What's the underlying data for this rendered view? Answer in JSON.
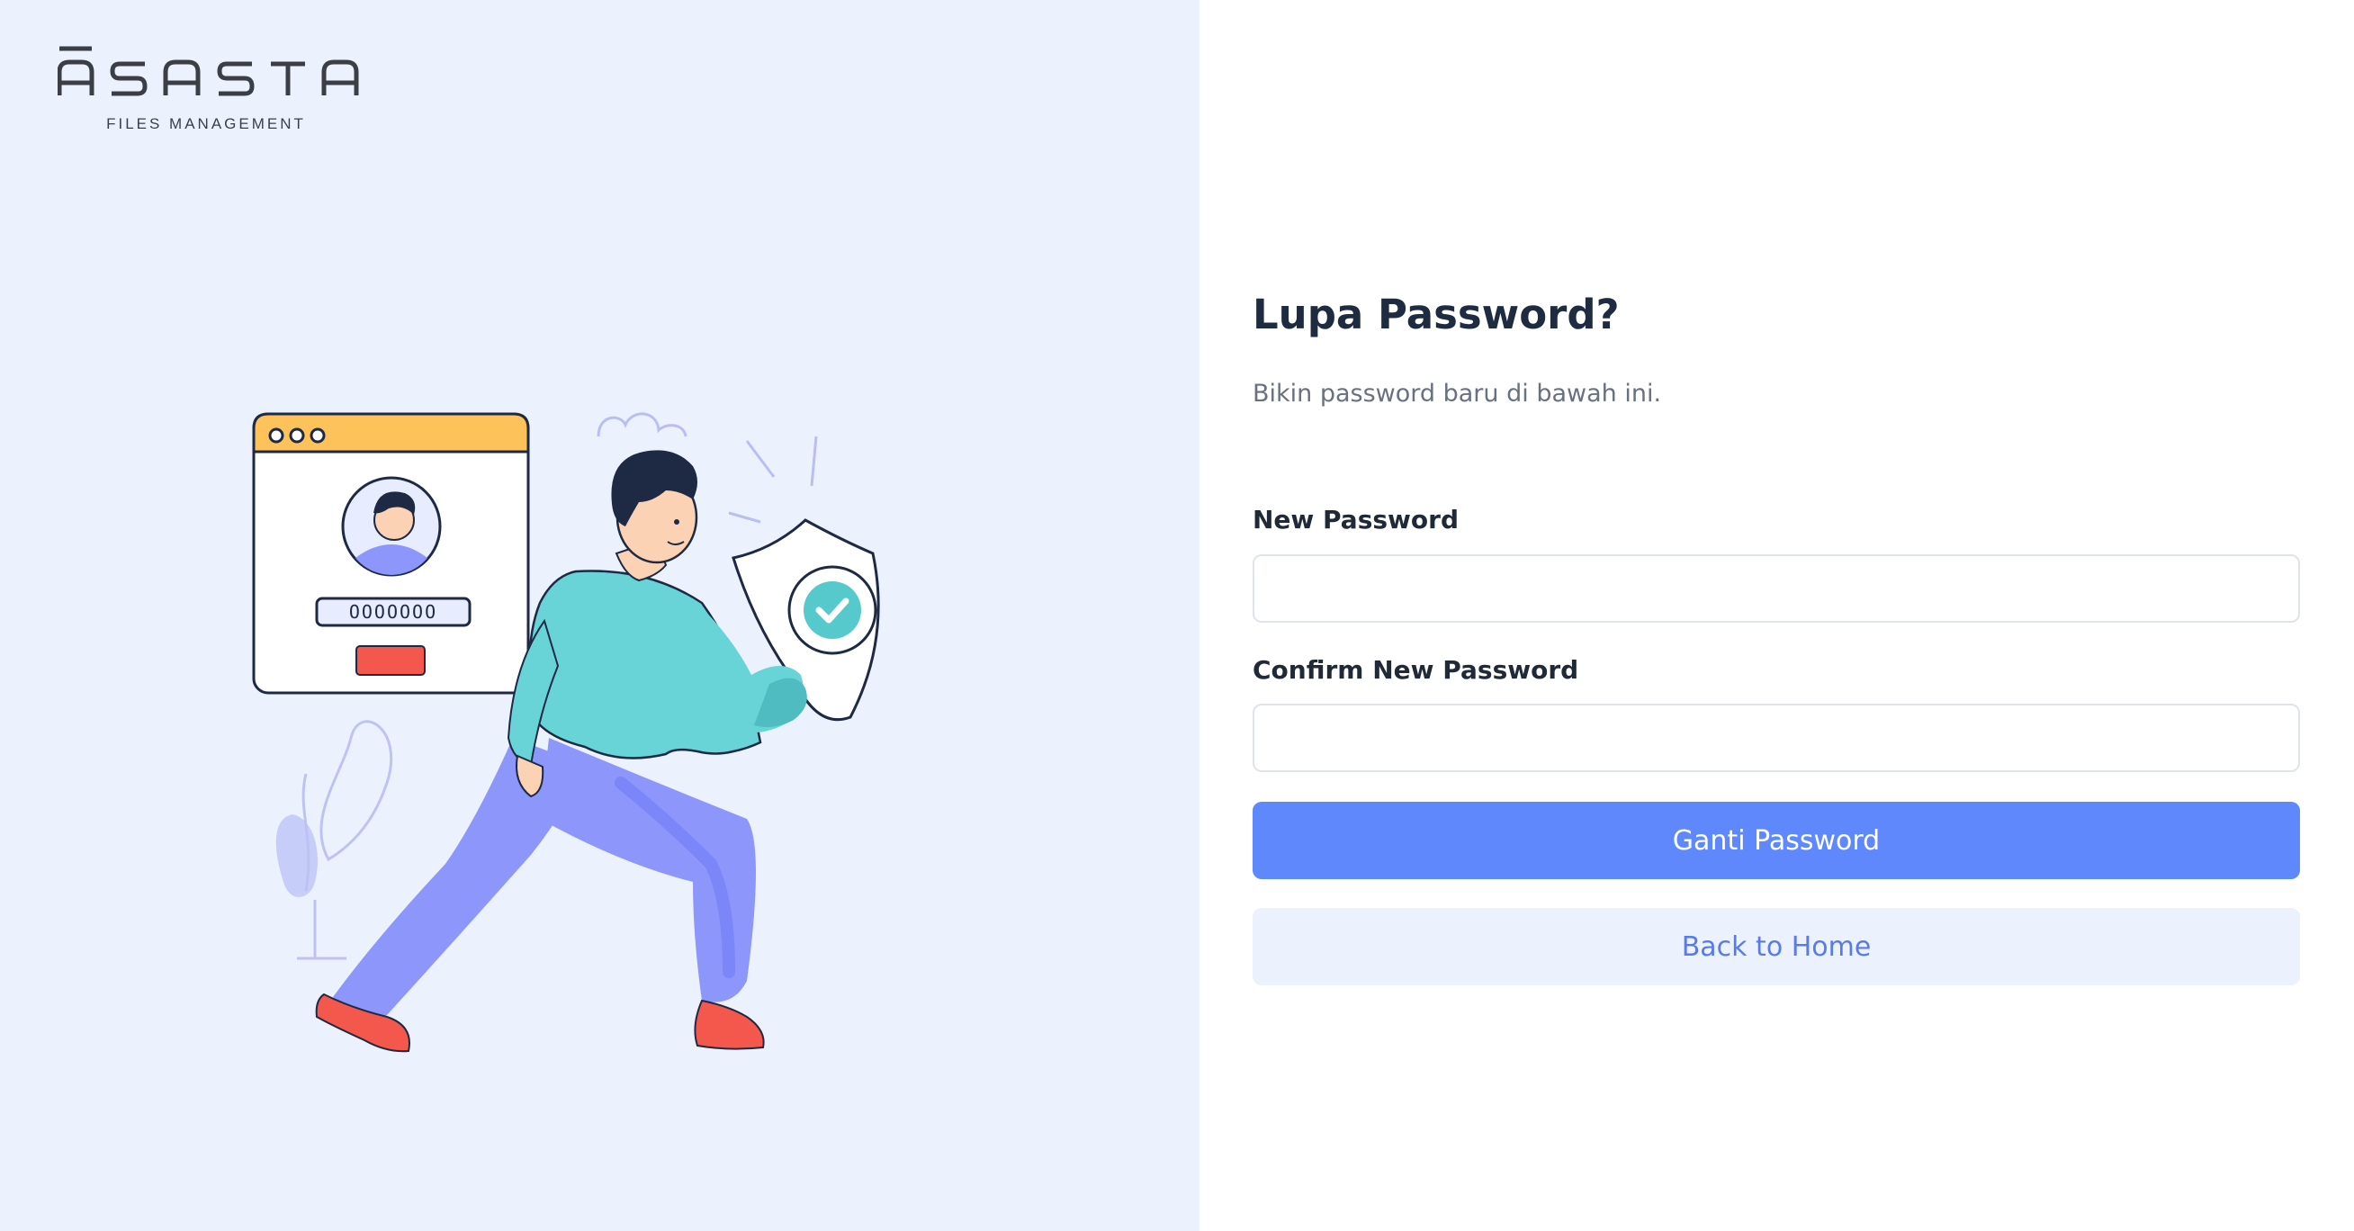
{
  "brand": {
    "name": "ĀSASTA",
    "tagline": "FILES MANAGEMENT"
  },
  "illustration": {
    "password_mask": "OOOOOOO",
    "colors": {
      "panel_background": "#ebf2fd",
      "shirt": "#68d4d8",
      "pants": "#8c96fb",
      "shoes": "#f4574b",
      "window_bar": "#fec25b",
      "window_button": "#f4574b",
      "shield_check": "#56c9cd"
    }
  },
  "form": {
    "title": "Lupa Password?",
    "subtitle": "Bikin password baru di bawah ini.",
    "new_password": {
      "label": "New Password",
      "value": "",
      "placeholder": ""
    },
    "confirm_password": {
      "label": "Confirm New Password",
      "value": "",
      "placeholder": ""
    },
    "submit_label": "Ganti Password",
    "back_label": "Back to Home"
  },
  "theme": {
    "primary": "#5e88fc",
    "secondary_background": "#ebf2fd",
    "heading": "#1f2b40"
  }
}
